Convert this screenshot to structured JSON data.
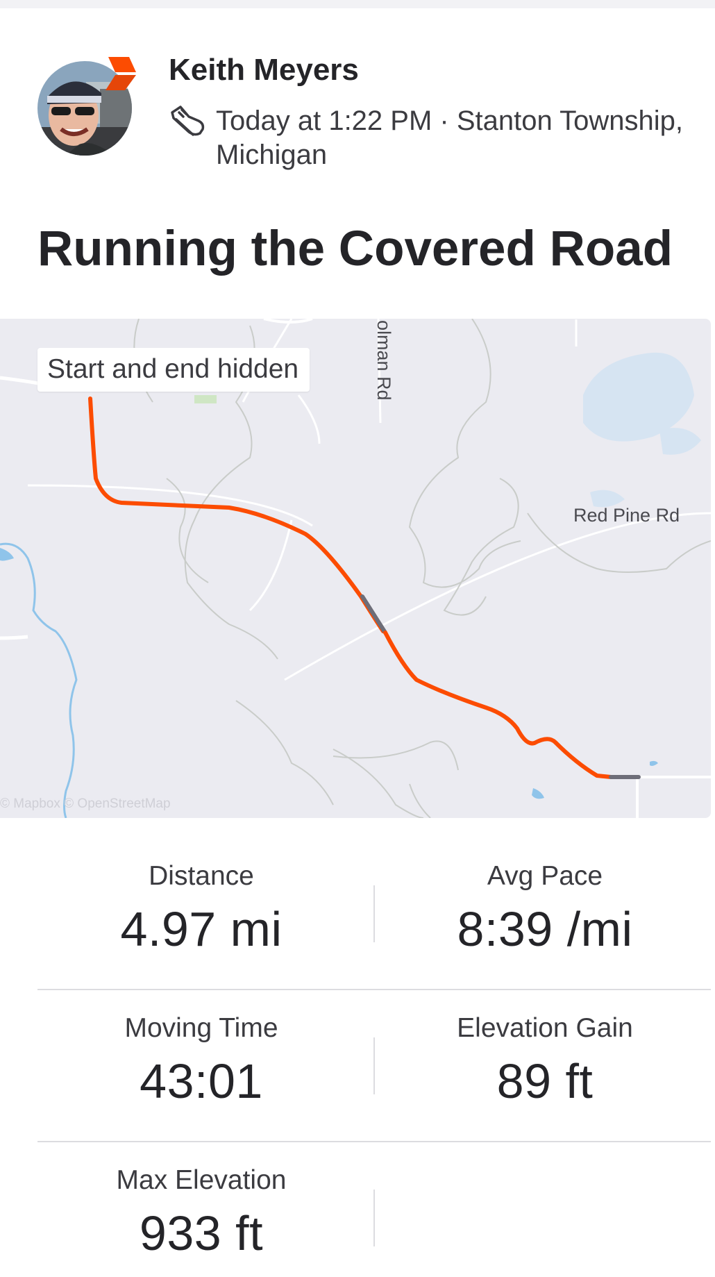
{
  "header": {
    "athlete_name": "Keith Meyers",
    "activity_icon": "running-shoe-icon",
    "meta_line": "Today at 1:22 PM · Stanton Township, Michigan"
  },
  "activity": {
    "title": "Running the Covered Road"
  },
  "map": {
    "privacy_chip": "Start and end hidden",
    "road_labels": {
      "red_pine": "Red Pine Rd",
      "holman": "olman Rd"
    },
    "attribution": "© Mapbox © OpenStreetMap",
    "colors": {
      "route": "#fc4c02",
      "hidden_segment": "#6d6d78",
      "water": "#8fc4ea",
      "land": "#ebebf1"
    }
  },
  "stats": {
    "distance": {
      "label": "Distance",
      "value": "4.97 mi"
    },
    "avg_pace": {
      "label": "Avg Pace",
      "value": "8:39 /mi"
    },
    "moving_time": {
      "label": "Moving Time",
      "value": "43:01"
    },
    "elevation_gain": {
      "label": "Elevation Gain",
      "value": "89 ft"
    },
    "max_elevation": {
      "label": "Max Elevation",
      "value": "933 ft"
    }
  },
  "theme": {
    "brand_color": "#fc4c02",
    "text_color": "#242428"
  }
}
